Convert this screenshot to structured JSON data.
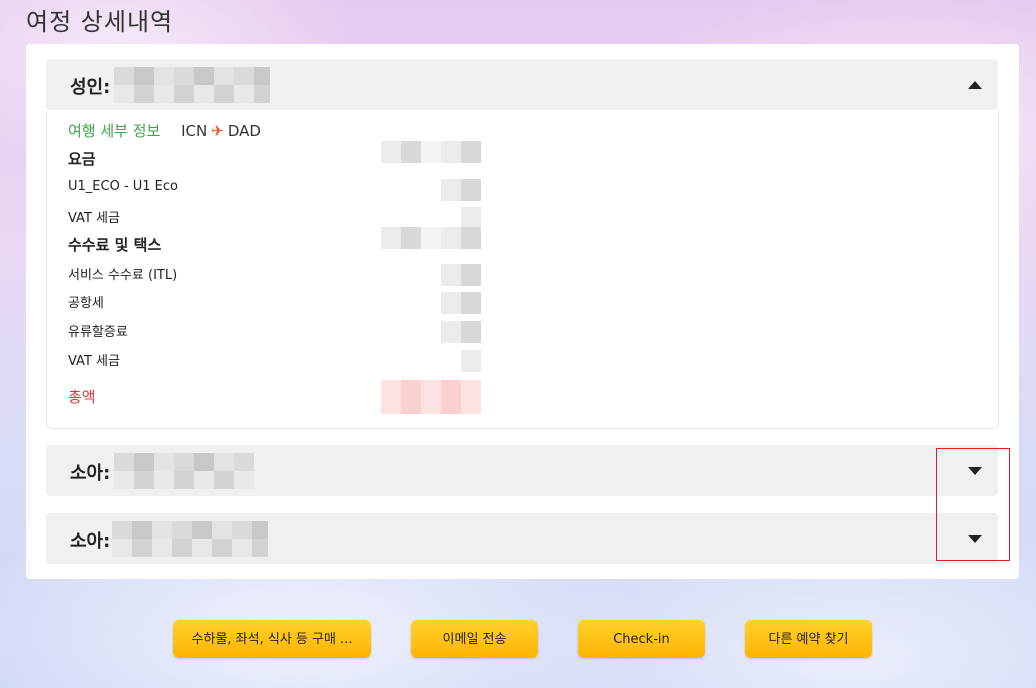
{
  "page_title": "여정 상세내역",
  "passengers": [
    {
      "label": "성인:",
      "expanded": true
    },
    {
      "label": "소아:",
      "expanded": false
    },
    {
      "label": "소아:",
      "expanded": false
    }
  ],
  "details": {
    "route_title": "여행 세부 정보",
    "origin": "ICN",
    "destination": "DAD",
    "fare_heading": "요금",
    "fare_class": "U1_ECO - U1 Eco",
    "fare_vat": "VAT 세금",
    "fees_heading": "수수료 및 택스",
    "service_fee": "서비스 수수료 (ITL)",
    "airport_tax": "공항세",
    "fuel_surcharge": "유류할증료",
    "fees_vat": "VAT 세금",
    "total_label": "총액"
  },
  "buttons": {
    "extras": "수하물, 좌석, 식사 등 구매 ...",
    "email": "이메일 전송",
    "checkin": "Check-in",
    "find_booking": "다른 예약 찾기"
  },
  "icons": {
    "plane": "plane-icon",
    "collapse": "chevron-up-icon",
    "expand": "chevron-down-icon"
  },
  "colors": {
    "accent_green": "#3aa84a",
    "total_red": "#d9383a",
    "button_yellow": "#ffc107",
    "highlight_red": "#e02020"
  }
}
